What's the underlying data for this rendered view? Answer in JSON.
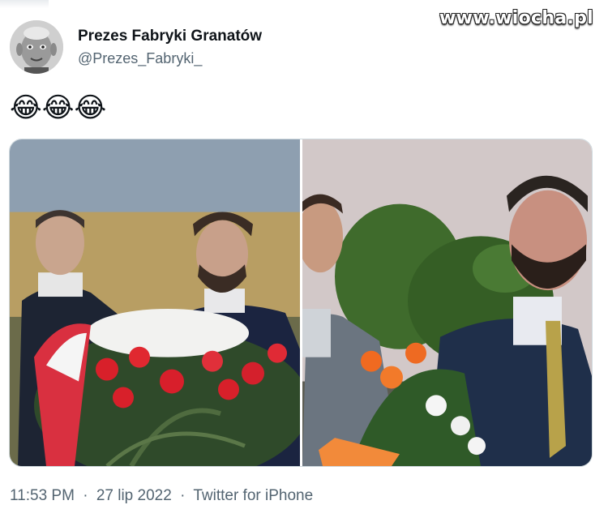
{
  "watermark": "www.wiocha.pl",
  "tweet": {
    "author": {
      "display_name": "Prezes Fabryki Granatów",
      "handle": "@Prezes_Fabryki_"
    },
    "text": "😂😂😂",
    "media": [
      {
        "subject": "two men in suits holding a red and white wreath of flowers in front of a wheat field"
      },
      {
        "subject": "two men in suits holding flowers in front of trees, still from a film"
      }
    ],
    "time": "11:53 PM",
    "separator": "·",
    "date": "27 lip 2022",
    "source": "Twitter for iPhone"
  },
  "colors": {
    "text_primary": "#0f1419",
    "text_secondary": "#536471",
    "border": "#cfd9de"
  }
}
